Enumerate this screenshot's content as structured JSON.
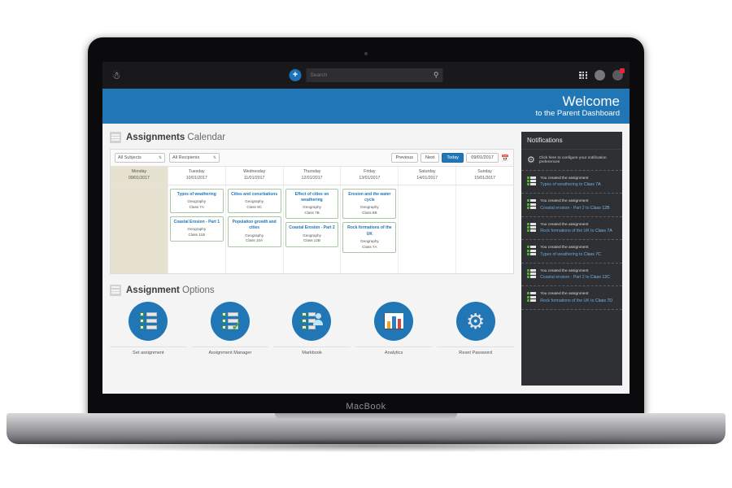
{
  "device": {
    "brand_label": "MacBook"
  },
  "topnav": {
    "brand_icon": "logo-icon",
    "add_label": "+",
    "search": {
      "placeholder": "Search",
      "value": "",
      "icon": "search-icon"
    },
    "grid_icon": "apps-grid-icon",
    "avatar_icon": "avatar",
    "alerts_icon": "alerts-icon",
    "alerts_badge": ""
  },
  "banner": {
    "title": "Welcome",
    "subtitle": "to the Parent Dashboard",
    "accent": "#2176b6"
  },
  "calendar": {
    "heading_bold": "Assignments",
    "heading_light": "Calendar",
    "icon": "calendar-icon",
    "filters": [
      {
        "name": "subject-filter",
        "value": "All Subjects"
      },
      {
        "name": "recipient-filter",
        "value": "All Recipients"
      }
    ],
    "buttons": {
      "previous": "Previous",
      "next": "Next",
      "today": "Today"
    },
    "date_value": "09/01/2017",
    "date_icon": "calendar-picker-icon",
    "days": [
      {
        "name": "Monday",
        "date": "09/01/2017",
        "today": true,
        "assignments": []
      },
      {
        "name": "Tuesday",
        "date": "10/01/2017",
        "today": false,
        "assignments": [
          {
            "title": "Types of weathering",
            "subject": "Geography",
            "class": "Class 7A"
          },
          {
            "title": "Coastal Erosion - Part 1",
            "subject": "Geography",
            "class": "Class 11B"
          }
        ]
      },
      {
        "name": "Wednesday",
        "date": "11/01/2017",
        "today": false,
        "assignments": [
          {
            "title": "Cities and conurbations",
            "subject": "Geography",
            "class": "Class 9C"
          },
          {
            "title": "Population growth and cities",
            "subject": "Geography",
            "class": "Class 10A"
          }
        ]
      },
      {
        "name": "Thursday",
        "date": "12/01/2017",
        "today": false,
        "assignments": [
          {
            "title": "Effect of cities on weathering",
            "subject": "Geography",
            "class": "Class 7B"
          },
          {
            "title": "Coastal Erosion - Part 2",
            "subject": "Geography",
            "class": "Class 12B"
          }
        ]
      },
      {
        "name": "Friday",
        "date": "13/01/2017",
        "today": false,
        "assignments": [
          {
            "title": "Erosion and the water cycle",
            "subject": "Geography",
            "class": "Class 8B"
          },
          {
            "title": "Rock formations of the UK",
            "subject": "Geography",
            "class": "Class 7A"
          }
        ]
      },
      {
        "name": "Saturday",
        "date": "14/01/2017",
        "today": false,
        "assignments": []
      },
      {
        "name": "Sunday",
        "date": "15/01/2017",
        "today": false,
        "assignments": []
      }
    ]
  },
  "options": {
    "heading_bold": "Assignment",
    "heading_light": "Options",
    "icon": "list-icon",
    "items": [
      {
        "label": "Set assignment",
        "icon": "checklist-icon"
      },
      {
        "label": "Assignment Manager",
        "icon": "checklist-tick-icon"
      },
      {
        "label": "Markbook",
        "icon": "checklist-person-icon"
      },
      {
        "label": "Analytics",
        "icon": "bar-chart-icon"
      },
      {
        "label": "Reset Password",
        "icon": "gear-icon"
      }
    ]
  },
  "notifications": {
    "title": "Notifications",
    "prefs_text": "Click here to configure your notification preferences",
    "prefs_icon": "gear-icon",
    "items": [
      {
        "line1": "You created the assignment",
        "assignment": "Types of weathering",
        "to": " to ",
        "class": "Class 7A"
      },
      {
        "line1": "You created the assignment",
        "assignment": "Coastal erosion - Part 2",
        "to": " to ",
        "class": "Class 12B"
      },
      {
        "line1": "You created the assignment",
        "assignment": "Rock formations of the UK",
        "to": " to ",
        "class": "Class 7A"
      },
      {
        "line1": "You created the assignment",
        "assignment": "Types of weathering",
        "to": " to ",
        "class": "Class 7C"
      },
      {
        "line1": "You created the assignment",
        "assignment": "Coastal erosion - Part 2",
        "to": " to ",
        "class": "Class 12C"
      },
      {
        "line1": "You created the assignment",
        "assignment": "Rock formations of the UK",
        "to": " to ",
        "class": "Class 7D"
      }
    ]
  }
}
